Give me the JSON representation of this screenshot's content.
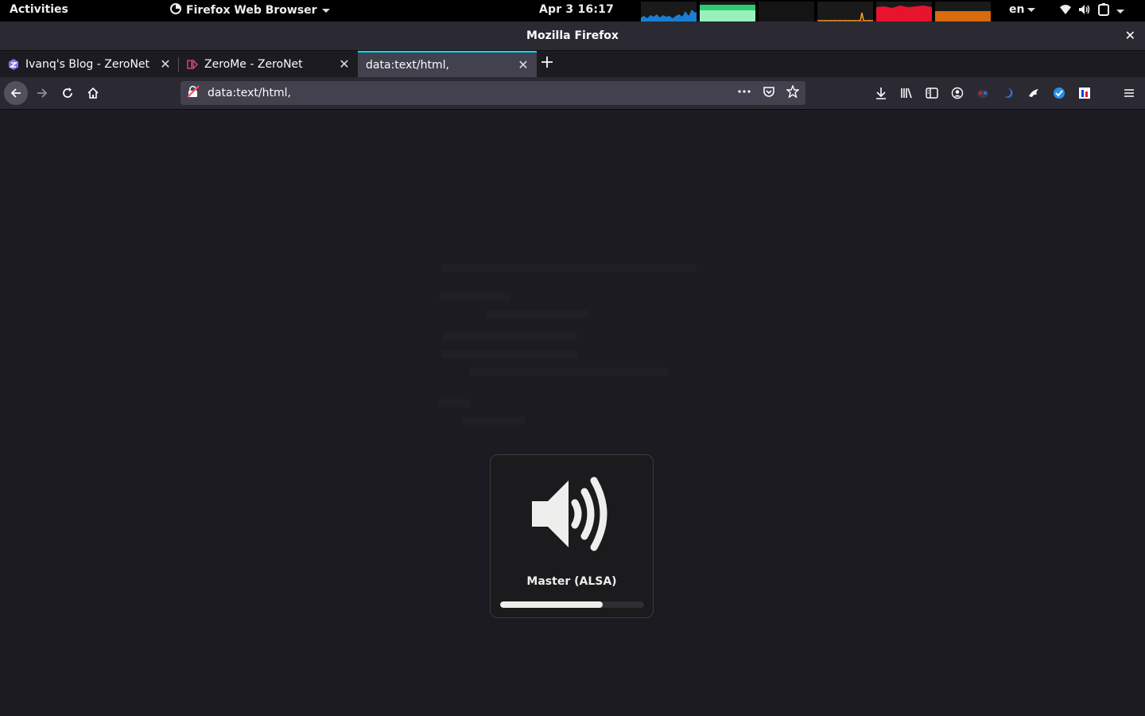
{
  "topbar": {
    "activities": "Activities",
    "app_menu": "Firefox Web Browser",
    "clock": "Apr 3  16:17",
    "language": "en",
    "graph_colors": [
      "#1a7fd4",
      "#2ecc71",
      "#888888",
      "#f5a623",
      "#e8142d",
      "#d96b0c"
    ]
  },
  "window": {
    "title": "Mozilla Firefox"
  },
  "tabs": [
    {
      "label": "Ivanq's Blog - ZeroNet",
      "icon": "zeronet-blog-icon"
    },
    {
      "label": "ZeroMe - ZeroNet",
      "icon": "zerome-icon"
    },
    {
      "label": "data:text/html,",
      "icon": "none",
      "active": true
    }
  ],
  "navbar": {
    "url": "data:text/html,",
    "accent_color": "#00ddff"
  },
  "osd": {
    "device": "Master (ALSA)",
    "volume_level": 0.71,
    "icon": "speaker-high-icon"
  }
}
